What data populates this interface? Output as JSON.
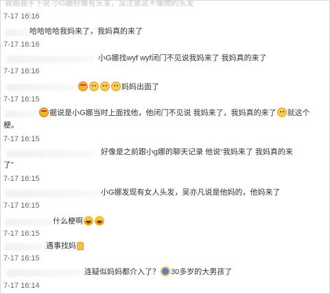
{
  "chat": {
    "top_partial_text": "我跟我手下说 小G娜好像有头发，没注意这不像她的头发",
    "messages": [
      {
        "time": "7-17 16:16",
        "text": "哈哈哈哈我妈来了，我妈真的来了"
      },
      {
        "time": "7-17 16:16",
        "text": "小G娜找wyf wyf闭门不见说我妈来了 我妈真的来了"
      },
      {
        "time": "7-17 16:15",
        "text": "妈妈出面了"
      },
      {
        "time": "7-17 16:15",
        "text_line1": "据说是小G娜当时上面找他，他闭门不见说 我妈来了，我妈真的来了",
        "text_line2_prefix": "就这个",
        "text_line2": "梗。"
      },
      {
        "time": "7-17 16:15",
        "text_line1": "好像是之前跟小g娜的聊天记录 他说“我妈来了 我妈真的来",
        "text_line2": "了”"
      },
      {
        "time": "7-17 16:15",
        "text": "小G娜发现有女人头发，吴亦凡说是他妈的，他妈来了"
      },
      {
        "time": "7-17 16:15",
        "text": "什么梗啊"
      },
      {
        "time": "7-17 16:15",
        "text": "遇事找妈"
      },
      {
        "time": "7-17 16:14",
        "text": "连疑似妈妈都介入了？",
        "text2": "30多岁的大男孩了"
      },
      {
        "time": "7-17 16:14",
        "text": ""
      }
    ],
    "first_time": "7-17 16:16"
  }
}
